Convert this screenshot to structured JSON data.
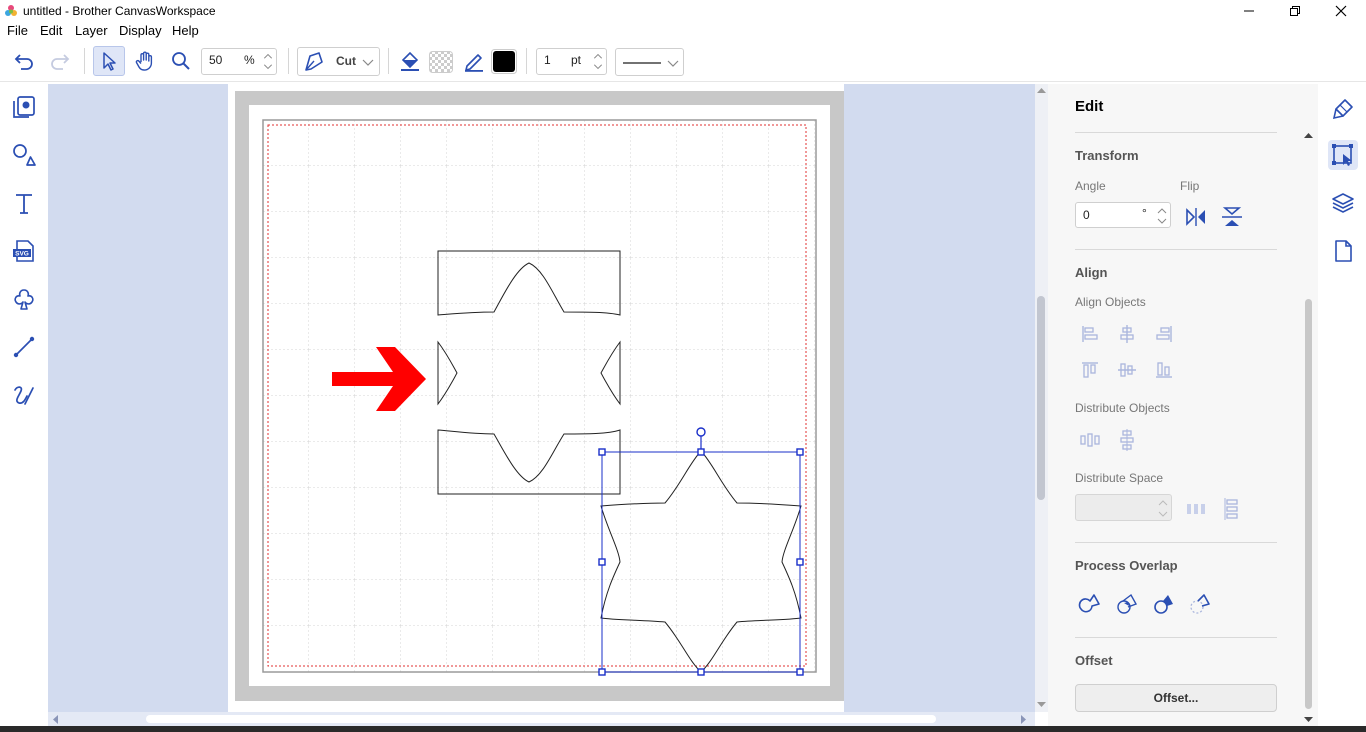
{
  "window": {
    "title": "untitled - Brother CanvasWorkspace"
  },
  "menu": [
    "File",
    "Edit",
    "Layer",
    "Display",
    "Help"
  ],
  "toolbar": {
    "zoom_value": "50",
    "zoom_unit": "%",
    "mode_label": "Cut",
    "line_width_value": "1",
    "line_width_unit": "pt",
    "fill_color": "#000000",
    "accent": "#2b4fb3"
  },
  "left_tools": [
    "pages-icon",
    "shapes-icon",
    "text-icon",
    "svg-import-icon",
    "cloud-shape-icon",
    "line-icon",
    "freehand-icon"
  ],
  "panel": {
    "title": "Edit",
    "transform": {
      "heading": "Transform",
      "angle_label": "Angle",
      "angle_value": "0",
      "angle_unit": "°",
      "flip_label": "Flip"
    },
    "align": {
      "heading": "Align",
      "align_objects_label": "Align Objects",
      "distribute_objects_label": "Distribute Objects",
      "distribute_space_label": "Distribute Space"
    },
    "process_overlap": {
      "heading": "Process Overlap"
    },
    "offset": {
      "heading": "Offset",
      "button_label": "Offset..."
    }
  },
  "canvas": {
    "background": "#d2dbef",
    "selection_color": "#1a2fc9",
    "arrow_color": "#ff0000",
    "cut_margin_color": "#e03030"
  }
}
